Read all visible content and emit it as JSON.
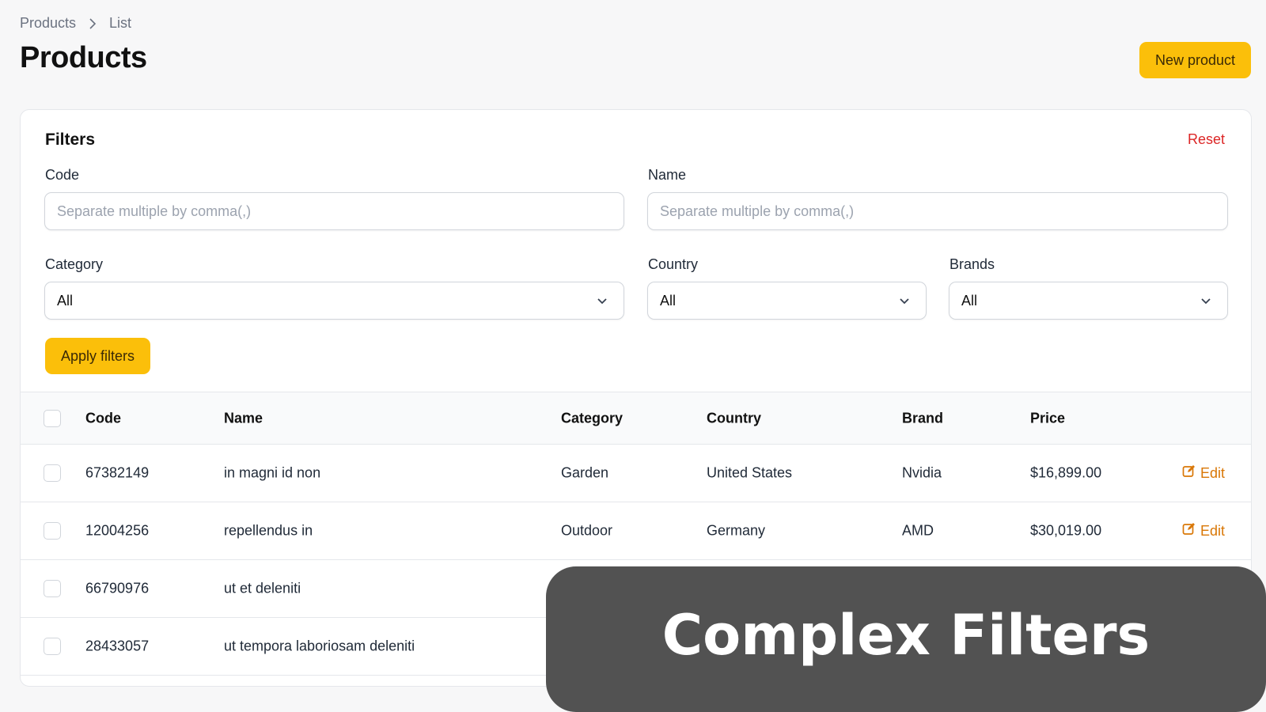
{
  "breadcrumb": {
    "items": [
      "Products",
      "List"
    ]
  },
  "page": {
    "title": "Products",
    "new_button": "New product"
  },
  "filters": {
    "title": "Filters",
    "reset": "Reset",
    "code": {
      "label": "Code",
      "placeholder": "Separate multiple by comma(,)"
    },
    "name": {
      "label": "Name",
      "placeholder": "Separate multiple by comma(,)"
    },
    "category": {
      "label": "Category",
      "value": "All"
    },
    "country": {
      "label": "Country",
      "value": "All"
    },
    "brands": {
      "label": "Brands",
      "value": "All"
    },
    "apply": "Apply filters"
  },
  "table": {
    "headers": [
      "Code",
      "Name",
      "Category",
      "Country",
      "Brand",
      "Price"
    ],
    "edit_label": "Edit",
    "rows": [
      {
        "code": "67382149",
        "name": "in magni id non",
        "category": "Garden",
        "country": "United States",
        "brand": "Nvidia",
        "price": "$16,899.00"
      },
      {
        "code": "12004256",
        "name": "repellendus in",
        "category": "Outdoor",
        "country": "Germany",
        "brand": "AMD",
        "price": "$30,019.00"
      },
      {
        "code": "66790976",
        "name": "ut et deleniti"
      },
      {
        "code": "28433057",
        "name": "ut tempora laboriosam deleniti"
      }
    ]
  },
  "overlay": {
    "text": "Complex Filters"
  },
  "colors": {
    "accent": "#fbbf0a",
    "reset": "#dc2626",
    "edit": "#d97706",
    "overlay": "#525252"
  }
}
